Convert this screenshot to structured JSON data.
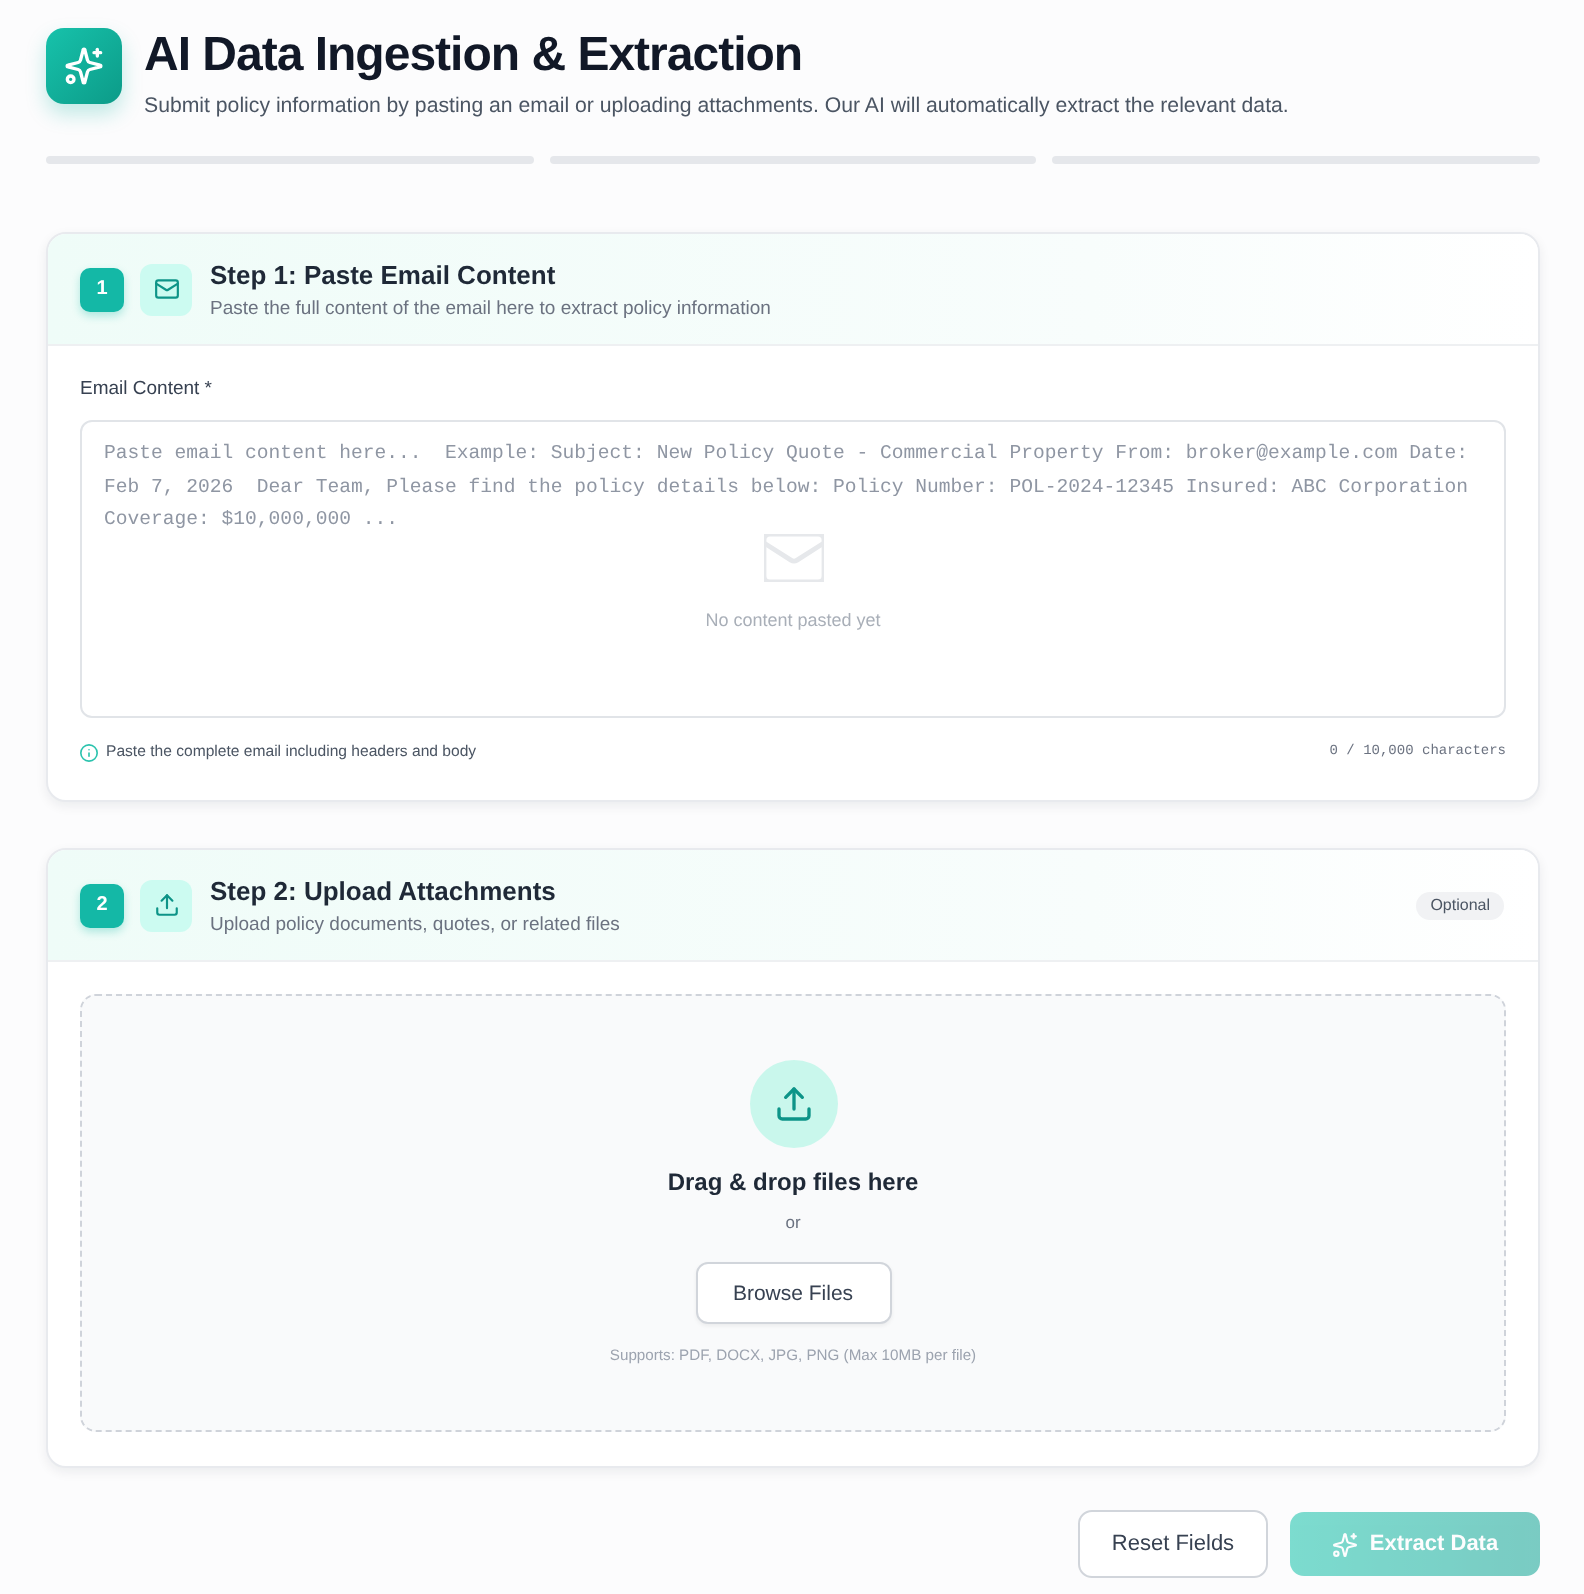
{
  "header": {
    "title": "AI Data Ingestion & Extraction",
    "subtitle": "Submit policy information by pasting an email or uploading attachments. Our AI will automatically extract the relevant data."
  },
  "progress_steps": [
    {
      "done": false
    },
    {
      "done": false
    },
    {
      "done": false
    }
  ],
  "steps": [
    {
      "kind": "email",
      "number": "1",
      "title": "Step 1: Paste Email Content",
      "subtitle": "Paste the full content of the email here to extract policy information",
      "field": {
        "label": "Email Content *",
        "placeholder": "Paste email content here...  Example: Subject: New Policy Quote - Commercial Property From: broker@example.com Date: Feb 7, 2026  Dear Team, Please find the policy details below: Policy Number: POL-2024-12345 Insured: ABC Corporation Coverage: $10,000,000 ...",
        "empty_text": "No content pasted yet",
        "hint": "Paste the complete email including headers and body",
        "counter": "0 / 10,000 characters"
      }
    },
    {
      "kind": "upload",
      "number": "2",
      "title": "Step 2: Upload Attachments",
      "subtitle": "Upload policy documents, quotes, or related files",
      "badge": "Optional",
      "dropzone": {
        "title": "Drag & drop files here",
        "separator": "or",
        "button": "Browse Files",
        "note": "Supports: PDF, DOCX, JPG, PNG (Max 10MB per file)"
      }
    }
  ],
  "buttons": [
    {
      "kind": "secondary",
      "label": "Reset Fields",
      "disabled": false
    },
    {
      "kind": "primary",
      "label": "Extract Data",
      "disabled": true
    }
  ]
}
